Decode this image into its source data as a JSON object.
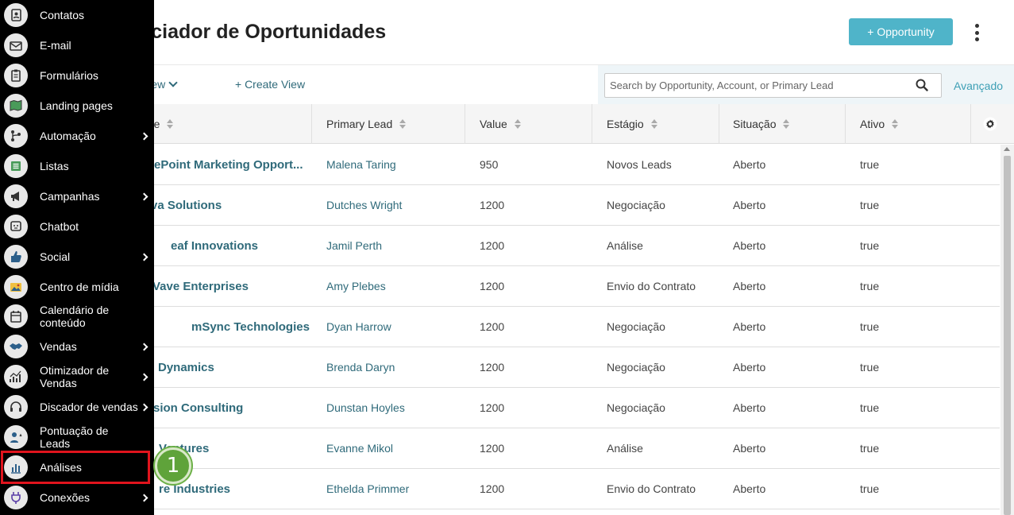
{
  "page": {
    "title": "Gerenciador de Oportunidades",
    "add_button": "+ Opportunity"
  },
  "toolbar": {
    "view_label": "efault View",
    "create_view": "+ Create View",
    "search_placeholder": "Search by Opportunity, Account, or Primary Lead",
    "advanced": "Avançado"
  },
  "table": {
    "columns": [
      "Oportunidade",
      "Primary Lead",
      "Value",
      "Estágio",
      "Situação",
      "Ativo"
    ],
    "first_column_visible": "ade",
    "rows": [
      {
        "name": "ePoint Marketing Opport...",
        "lead": "Malena Taring",
        "value": "950",
        "stage": "Novos Leads",
        "status": "Aberto",
        "active": "true"
      },
      {
        "name": "va Solutions",
        "lead": "Dutches Wright",
        "value": "1200",
        "stage": "Negociação",
        "status": "Aberto",
        "active": "true"
      },
      {
        "name": "eaf Innovations",
        "lead": "Jamil Perth",
        "value": "1200",
        "stage": "Análise",
        "status": "Aberto",
        "active": "true"
      },
      {
        "name": "Vave Enterprises",
        "lead": "Amy Plebes",
        "value": "1200",
        "stage": "Envio do Contrato",
        "status": "Aberto",
        "active": "true"
      },
      {
        "name": "mSync Technologies",
        "lead": "Dyan Harrow",
        "value": "1200",
        "stage": "Negociação",
        "status": "Aberto",
        "active": "true"
      },
      {
        "name": "Dynamics",
        "lead": "Brenda Daryn",
        "value": "1200",
        "stage": "Negociação",
        "status": "Aberto",
        "active": "true"
      },
      {
        "name": "sion Consulting",
        "lead": "Dunstan Hoyles",
        "value": "1200",
        "stage": "Negociação",
        "status": "Aberto",
        "active": "true"
      },
      {
        "name": "Ventures",
        "lead": "Evanne Mikol",
        "value": "1200",
        "stage": "Análise",
        "status": "Aberto",
        "active": "true"
      },
      {
        "name": "re Industries",
        "lead": "Ethelda Primmer",
        "value": "1200",
        "stage": "Envio do Contrato",
        "status": "Aberto",
        "active": "true"
      }
    ]
  },
  "sidebar": {
    "items": [
      {
        "label": "Contatos",
        "icon": "contacts-icon",
        "submenu": false
      },
      {
        "label": "E-mail",
        "icon": "email-icon",
        "submenu": false
      },
      {
        "label": "Formulários",
        "icon": "forms-icon",
        "submenu": false
      },
      {
        "label": "Landing pages",
        "icon": "landing-pages-icon",
        "submenu": false
      },
      {
        "label": "Automação",
        "icon": "automation-icon",
        "submenu": true
      },
      {
        "label": "Listas",
        "icon": "lists-icon",
        "submenu": false
      },
      {
        "label": "Campanhas",
        "icon": "megaphone-icon",
        "submenu": true
      },
      {
        "label": "Chatbot",
        "icon": "chatbot-icon",
        "submenu": false
      },
      {
        "label": "Social",
        "icon": "thumbs-up-icon",
        "submenu": true
      },
      {
        "label": "Centro de mídia",
        "icon": "media-icon",
        "submenu": false
      },
      {
        "label": "Calendário de conteúdo",
        "icon": "calendar-icon",
        "submenu": false
      },
      {
        "label": "Vendas",
        "icon": "handshake-icon",
        "submenu": true
      },
      {
        "label": "Otimizador de Vendas",
        "icon": "sales-optimizer-icon",
        "submenu": true
      },
      {
        "label": "Discador de vendas",
        "icon": "headset-icon",
        "submenu": true
      },
      {
        "label": "Pontuação de Leads",
        "icon": "lead-scoring-icon",
        "submenu": false
      },
      {
        "label": "Análises",
        "icon": "analytics-icon",
        "submenu": false
      },
      {
        "label": "Conexões",
        "icon": "plug-icon",
        "submenu": true
      }
    ]
  },
  "callout": {
    "step": "1",
    "highlighted_item": "Análises"
  },
  "colors": {
    "accent": "#4fb4c9",
    "link": "#2f6a7a",
    "highlight": "#e0141d",
    "badge": "#5fa33a",
    "sidebar_bg": "#000000"
  }
}
